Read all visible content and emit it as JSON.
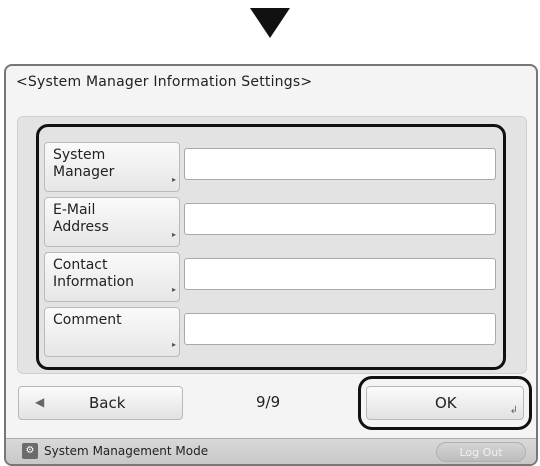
{
  "screen": {
    "title": "<System Manager Information Settings>"
  },
  "form": {
    "fields": [
      {
        "label": "System\nManager",
        "value": ""
      },
      {
        "label": "E-Mail\nAddress",
        "value": ""
      },
      {
        "label": "Contact\nInformation",
        "value": ""
      },
      {
        "label": "Comment",
        "value": ""
      }
    ],
    "corner_marker": "▸"
  },
  "footer": {
    "back_label": "Back",
    "back_icon": "left-arrow-icon",
    "page_indicator": "9/9",
    "ok_label": "OK",
    "ok_icon": "enter-corner-icon"
  },
  "status": {
    "mode_icon": "system-management-icon",
    "mode_text": "System Management Mode",
    "logout_label": "Log Out"
  },
  "colors": {
    "screen_bg": "#f4f4f4",
    "panel_bg": "#e3e3e3",
    "highlight": "#111111",
    "status_bg": "#c7c7c7"
  }
}
